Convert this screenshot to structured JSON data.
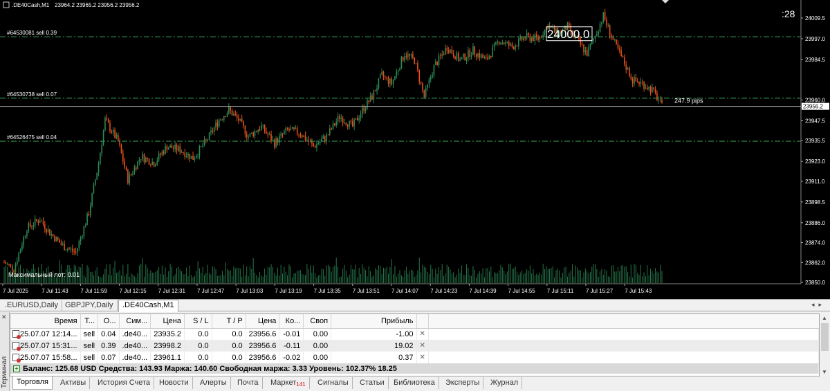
{
  "chart": {
    "symbol_header": ".DE40Cash,M1",
    "ohlc_header": "23964.2 23965.2 23956.2 23956.2",
    "countdown": ":28",
    "big_label": "24000.0",
    "pips_label": "247.9 pips",
    "max_lot_label": "Максимальный лот: 0.01",
    "order_lines": [
      {
        "label": "#64530081 sell 0.39",
        "price": 23998.2
      },
      {
        "label": "#64530738 sell 0.07",
        "price": 23961.1
      },
      {
        "label": "#64526475 sell 0.04",
        "price": 23935.2
      }
    ],
    "current_price": 23956.2,
    "current_price_label": "23956.2",
    "price_ticks": [
      {
        "v": 24009.5,
        "t": "24009.5"
      },
      {
        "v": 23997.0,
        "t": "23997.0"
      },
      {
        "v": 23984.5,
        "t": "23984.5"
      },
      {
        "v": 23960.0,
        "t": "23960.0"
      },
      {
        "v": 23947.5,
        "t": "23947.5"
      },
      {
        "v": 23935.5,
        "t": "23935.5"
      },
      {
        "v": 23923.0,
        "t": "23923.0"
      },
      {
        "v": 23911.0,
        "t": "23911.0"
      },
      {
        "v": 23898.5,
        "t": "23898.5"
      },
      {
        "v": 23886.0,
        "t": "23886.0"
      },
      {
        "v": 23874.0,
        "t": "23874.0"
      },
      {
        "v": 23862.0,
        "t": "23862.0"
      },
      {
        "v": 23850.0,
        "t": "23850.0"
      }
    ],
    "time_ticks": [
      "7 Jul 2025",
      "7 Jul 11:43",
      "7 Jul 11:59",
      "7 Jul 12:15",
      "7 Jul 12:31",
      "7 Jul 12:47",
      "7 Jul 13:03",
      "7 Jul 13:19",
      "7 Jul 13:35",
      "7 Jul 13:51",
      "7 Jul 14:07",
      "7 Jul 14:23",
      "7 Jul 14:39",
      "7 Jul 14:55",
      "7 Jul 15:11",
      "7 Jul 15:27",
      "7 Jul 15:43"
    ],
    "colors": {
      "bull": "#2e8b57",
      "bear": "#e8501c",
      "grid_line": "#3aa55a",
      "text": "#ffffff"
    }
  },
  "chart_data": {
    "type": "candlestick",
    "ylim": [
      23848.0,
      24014.0
    ],
    "key_points": [
      [
        0,
        23862
      ],
      [
        6,
        23858
      ],
      [
        14,
        23883
      ],
      [
        22,
        23888
      ],
      [
        28,
        23880
      ],
      [
        36,
        23872
      ],
      [
        44,
        23868
      ],
      [
        52,
        23892
      ],
      [
        58,
        23922
      ],
      [
        62,
        23948
      ],
      [
        70,
        23935
      ],
      [
        76,
        23912
      ],
      [
        84,
        23926
      ],
      [
        92,
        23922
      ],
      [
        100,
        23932
      ],
      [
        108,
        23930
      ],
      [
        116,
        23925
      ],
      [
        124,
        23935
      ],
      [
        132,
        23948
      ],
      [
        138,
        23954
      ],
      [
        144,
        23948
      ],
      [
        150,
        23938
      ],
      [
        158,
        23944
      ],
      [
        166,
        23934
      ],
      [
        174,
        23942
      ],
      [
        182,
        23940
      ],
      [
        190,
        23932
      ],
      [
        198,
        23938
      ],
      [
        206,
        23950
      ],
      [
        214,
        23944
      ],
      [
        220,
        23954
      ],
      [
        226,
        23962
      ],
      [
        232,
        23975
      ],
      [
        238,
        23970
      ],
      [
        246,
        23988
      ],
      [
        252,
        23984
      ],
      [
        258,
        23962
      ],
      [
        264,
        23980
      ],
      [
        272,
        23992
      ],
      [
        280,
        23984
      ],
      [
        288,
        23990
      ],
      [
        296,
        23984
      ],
      [
        304,
        23996
      ],
      [
        312,
        23992
      ],
      [
        320,
        23998
      ],
      [
        328,
        23997
      ],
      [
        334,
        24005
      ],
      [
        340,
        24000
      ],
      [
        346,
        24004
      ],
      [
        352,
        23996
      ],
      [
        358,
        23988
      ],
      [
        364,
        24001
      ],
      [
        368,
        24011
      ],
      [
        374,
        23996
      ],
      [
        380,
        23984
      ],
      [
        386,
        23972
      ],
      [
        392,
        23970
      ],
      [
        398,
        23966
      ],
      [
        402,
        23960
      ],
      [
        404,
        23956
      ]
    ],
    "candle_count": 405
  },
  "tabs": {
    "chart_tabs": [
      ".EURUSD,Daily",
      "GBPJPY,Daily",
      ".DE40Cash,M1"
    ],
    "bottom_tabs": [
      {
        "label": "Торговля"
      },
      {
        "label": "Активы"
      },
      {
        "label": "История Счета"
      },
      {
        "label": "Новости"
      },
      {
        "label": "Алерты"
      },
      {
        "label": "Почта"
      },
      {
        "label": "Маркет",
        "badge": "141"
      },
      {
        "label": "Сигналы"
      },
      {
        "label": "Статьи"
      },
      {
        "label": "Библиотека"
      },
      {
        "label": "Эксперты"
      },
      {
        "label": "Журнал"
      }
    ]
  },
  "terminal": {
    "side_label": "Терминал",
    "columns": [
      "Время",
      "Т...",
      "О...",
      "Сим...",
      "Цена",
      "S / L",
      "T / P",
      "Цена",
      "Ко...",
      "Своп",
      "Прибыль"
    ],
    "rows": [
      [
        "25.07.07 12:14...",
        "sell",
        "0.04",
        ".de40...",
        "23935.2",
        "0.0",
        "0.0",
        "23956.6",
        "-0.01",
        "0.00",
        "-1.00"
      ],
      [
        "25.07.07 15:31...",
        "sell",
        "0.39",
        ".de40...",
        "23998.2",
        "0.0",
        "0.0",
        "23956.6",
        "-0.11",
        "0.00",
        "19.02"
      ],
      [
        "25.07.07 15:58...",
        "sell",
        "0.07",
        ".de40...",
        "23961.1",
        "0.0",
        "0.0",
        "23956.6",
        "-0.02",
        "0.00",
        "0.37"
      ]
    ],
    "balance_line": "Баланс: 125.68 USD  Средства: 143.93  Маржа: 140.60  Свободная маржа: 3.33  Уровень: 102.37%  18.25"
  }
}
